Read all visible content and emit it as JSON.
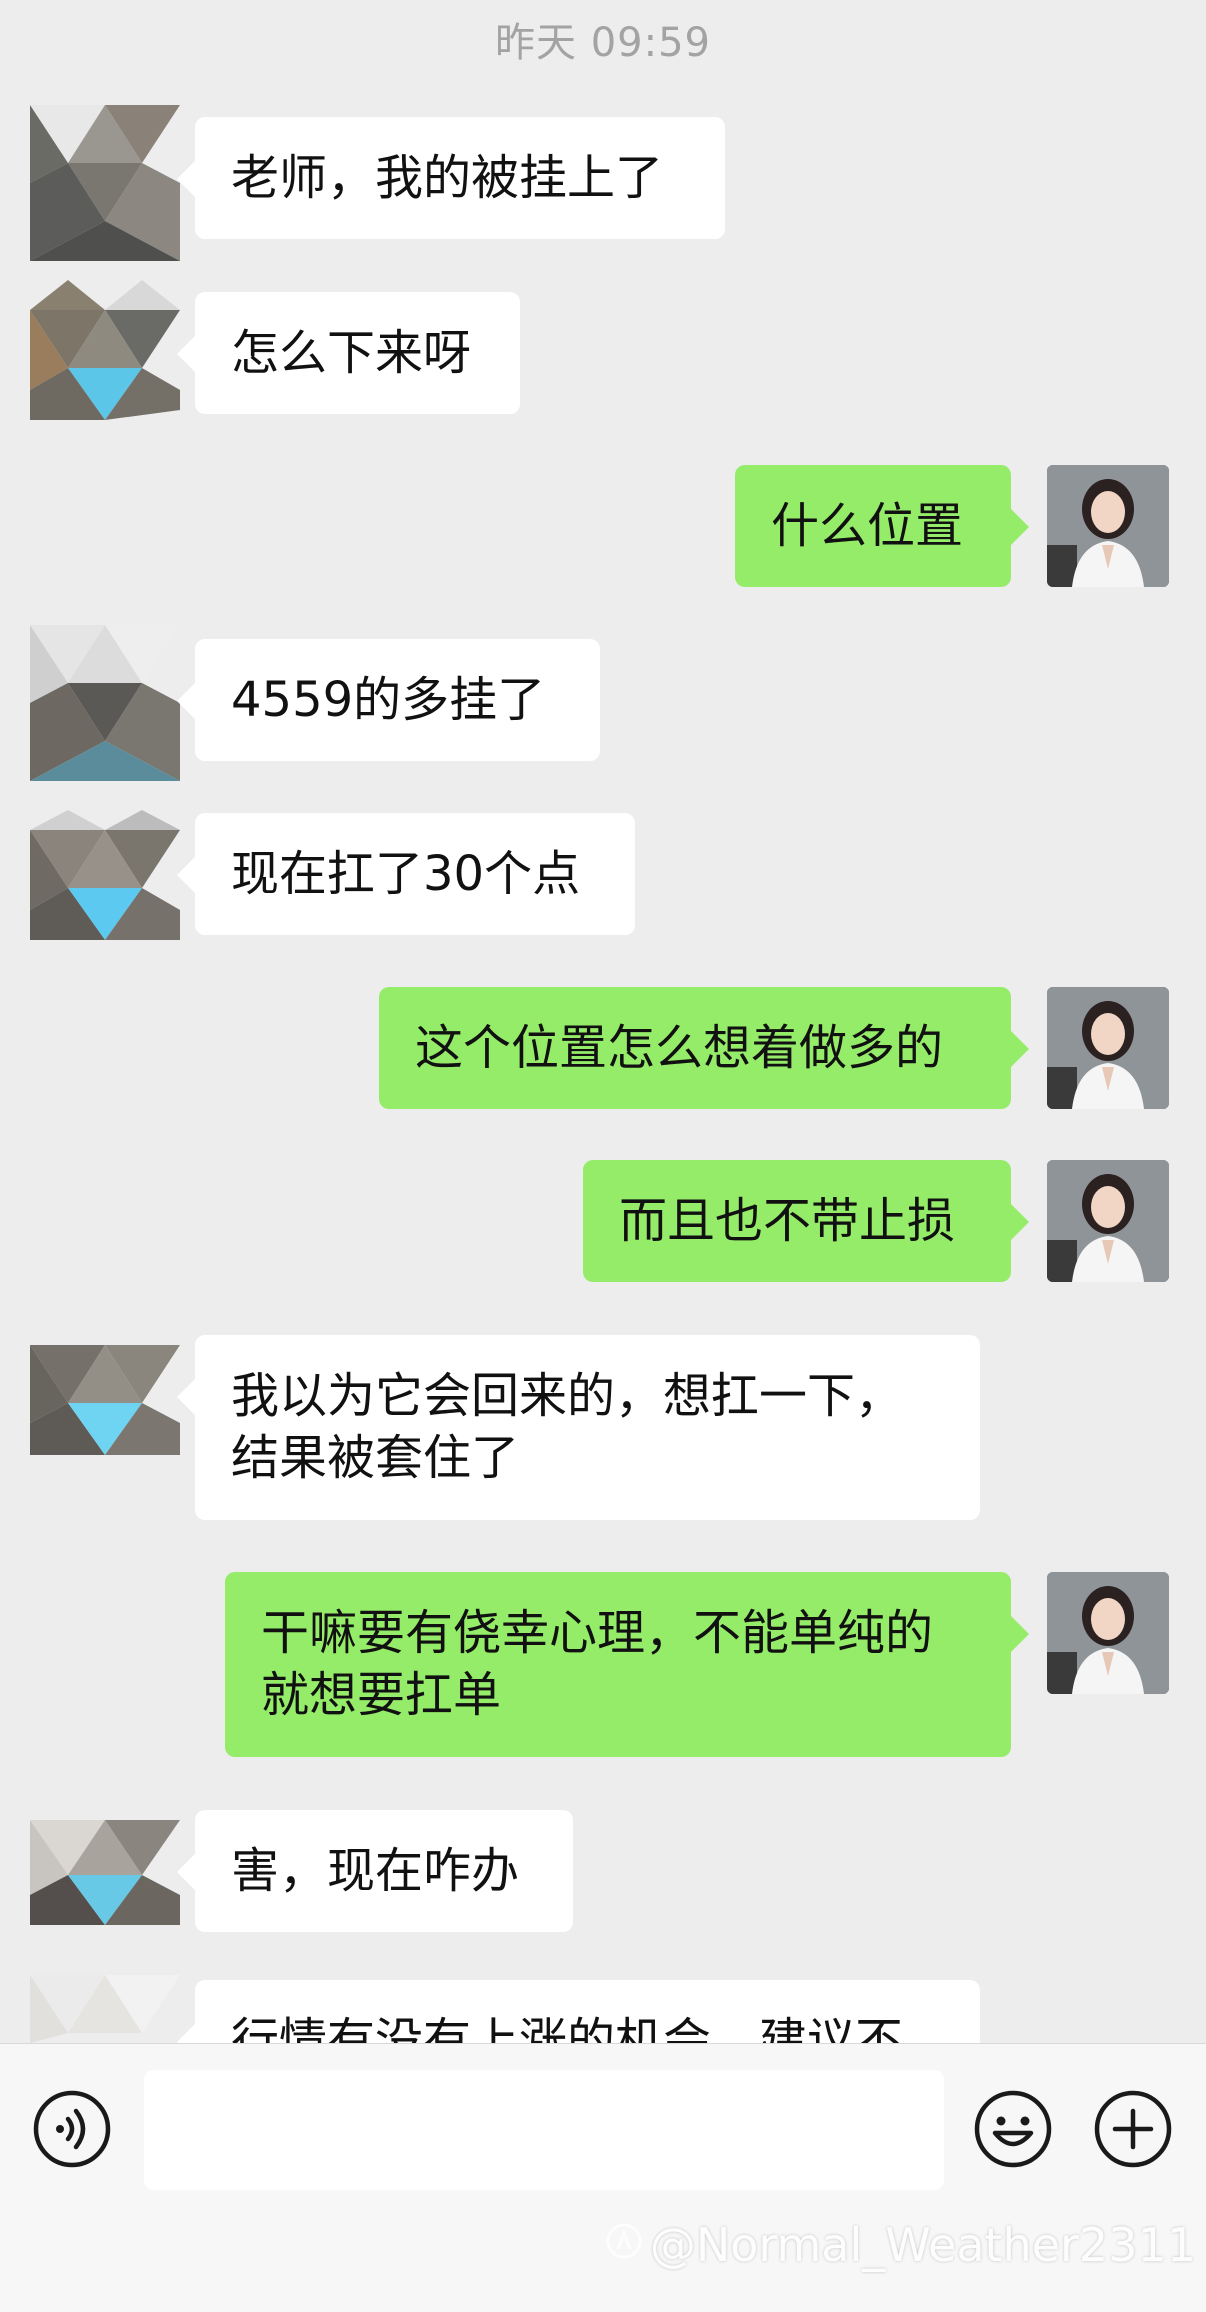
{
  "timestamp": "昨天 09:59",
  "messages": [
    {
      "side": "in",
      "lines": [
        "老师，我的被挂上了"
      ]
    },
    {
      "side": "in",
      "lines": [
        "怎么下来呀"
      ]
    },
    {
      "side": "out",
      "lines": [
        "什么位置"
      ]
    },
    {
      "side": "in",
      "lines": [
        "4559的多挂了"
      ]
    },
    {
      "side": "in",
      "lines": [
        "现在扛了30个点"
      ]
    },
    {
      "side": "out",
      "lines": [
        "这个位置怎么想着做多的"
      ]
    },
    {
      "side": "out",
      "lines": [
        "而且也不带止损"
      ]
    },
    {
      "side": "in",
      "lines": [
        "我以为它会回来的，想扛一下，",
        "结果被套住了"
      ]
    },
    {
      "side": "out",
      "lines": [
        "干嘛要有侥幸心理，不能单纯的",
        "就想要扛单"
      ]
    },
    {
      "side": "in",
      "lines": [
        "害，现在咋办"
      ]
    },
    {
      "side": "in",
      "lines": [
        "行情有没有上涨的机会，建议不"
      ]
    }
  ],
  "input": {
    "value": "",
    "placeholder": ""
  },
  "icons": {
    "voice": "voice-icon",
    "emoji": "emoji-icon",
    "plus": "plus-icon"
  },
  "watermark": "@Normal_Weather2311",
  "colors": {
    "outgoing_bubble": "#95ec69",
    "incoming_bubble": "#ffffff",
    "background": "#ededed"
  }
}
